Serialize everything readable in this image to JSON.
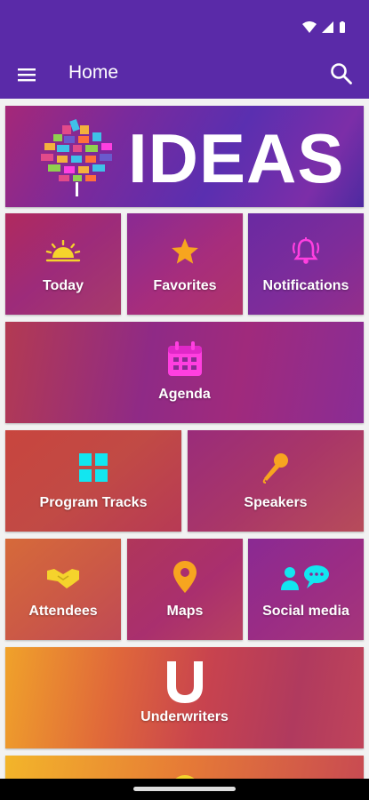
{
  "appbar": {
    "title": "Home"
  },
  "banner": {
    "logo_text": "IDEAS"
  },
  "tiles": [
    {
      "label": "Today",
      "icon": "sunrise-icon"
    },
    {
      "label": "Favorites",
      "icon": "star-icon"
    },
    {
      "label": "Notifications",
      "icon": "bell-icon"
    },
    {
      "label": "Agenda",
      "icon": "calendar-icon"
    },
    {
      "label": "Program Tracks",
      "icon": "grid-icon"
    },
    {
      "label": "Speakers",
      "icon": "microphone-icon"
    },
    {
      "label": "Attendees",
      "icon": "handshake-icon"
    },
    {
      "label": "Maps",
      "icon": "map-pin-icon"
    },
    {
      "label": "Social media",
      "icon": "people-chat-icon"
    },
    {
      "label": "Underwriters",
      "icon": "underwriters-u-icon"
    }
  ],
  "colors": {
    "appbar": "#5a2aa8",
    "icon_yellow": "#f5d32c",
    "icon_orange": "#f7a51f",
    "icon_magenta": "#ff3fe0",
    "icon_cyan": "#12e6f0"
  }
}
